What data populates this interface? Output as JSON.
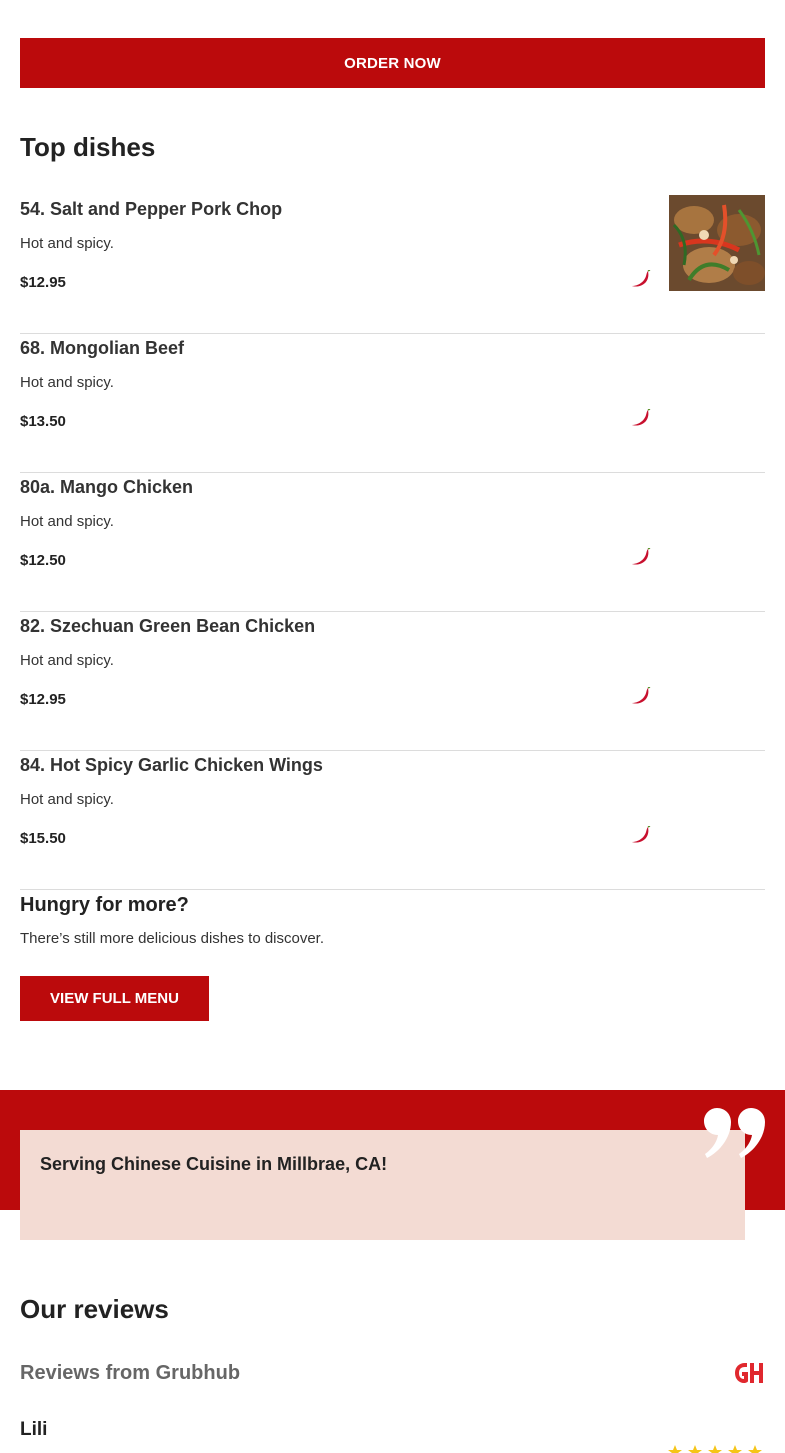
{
  "order_button": {
    "label": "ORDER NOW"
  },
  "top_dishes": {
    "title": "Top dishes",
    "items": [
      {
        "name": "54. Salt and Pepper Pork Chop",
        "description": "Hot and spicy.",
        "price": "$12.95",
        "spicy_icon": "chili-pepper-icon",
        "has_image": true
      },
      {
        "name": "68. Mongolian Beef",
        "description": "Hot and spicy.",
        "price": "$13.50",
        "spicy_icon": "chili-pepper-icon",
        "has_image": false
      },
      {
        "name": "80a. Mango Chicken",
        "description": "Hot and spicy.",
        "price": "$12.50",
        "spicy_icon": "chili-pepper-icon",
        "has_image": false
      },
      {
        "name": "82. Szechuan Green Bean Chicken",
        "description": "Hot and spicy.",
        "price": "$12.95",
        "spicy_icon": "chili-pepper-icon",
        "has_image": false
      },
      {
        "name": "84. Hot Spicy Garlic Chicken Wings",
        "description": "Hot and spicy.",
        "price": "$15.50",
        "spicy_icon": "chili-pepper-icon",
        "has_image": false
      }
    ]
  },
  "more": {
    "title": "Hungry for more?",
    "text": "There’s still more delicious dishes to discover.",
    "button_label": "VIEW FULL MENU"
  },
  "quote": {
    "text": "Serving Chinese Cuisine in Millbrae, CA!",
    "icon": "quote-icon"
  },
  "reviews": {
    "title": "Our reviews",
    "source": "Reviews from Grubhub",
    "source_logo": "grubhub-logo",
    "first_reviewer": "Lili",
    "rating": 5
  },
  "colors": {
    "brand_red": "#bb0a0c",
    "quote_card": "#f3dbd3",
    "star": "#f5c518"
  }
}
